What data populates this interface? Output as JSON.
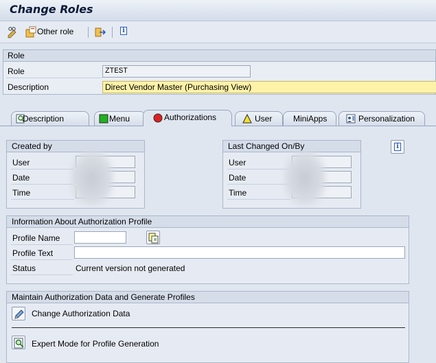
{
  "title": "Change Roles",
  "toolbar": {
    "other_role": "Other role"
  },
  "role_section": {
    "header": "Role",
    "role_label": "Role",
    "role_value": "ZTEST",
    "description_label": "Description",
    "description_value": "Direct Vendor Master (Purchasing View)"
  },
  "tabs": [
    {
      "label": "Description",
      "icon": "description-tab-icon"
    },
    {
      "label": "Menu",
      "icon": "green-square-icon"
    },
    {
      "label": "Authorizations",
      "icon": "red-circle-icon",
      "active": true
    },
    {
      "label": "User",
      "icon": "yellow-triangle-icon"
    },
    {
      "label": "MiniApps",
      "icon": ""
    },
    {
      "label": "Personalization",
      "icon": "personalization-icon"
    }
  ],
  "created_by": {
    "header": "Created by",
    "user": "User",
    "date": "Date",
    "time": "Time"
  },
  "last_changed": {
    "header": "Last Changed On/By",
    "user": "User",
    "date": "Date",
    "time": "Time"
  },
  "auth_profile": {
    "header": "Information About Authorization Profile",
    "profile_name_label": "Profile Name",
    "profile_name_value": "",
    "profile_text_label": "Profile Text",
    "profile_text_value": "",
    "status_label": "Status",
    "status_value": "Current version not generated"
  },
  "maintain": {
    "header": "Maintain Authorization Data and Generate Profiles",
    "change_auth": "Change Authorization Data",
    "expert_mode": "Expert Mode for Profile Generation"
  },
  "colors": {
    "background": "#dfe6f0",
    "description_highlight": "#fdf2a8",
    "active_status": "#e02020"
  }
}
